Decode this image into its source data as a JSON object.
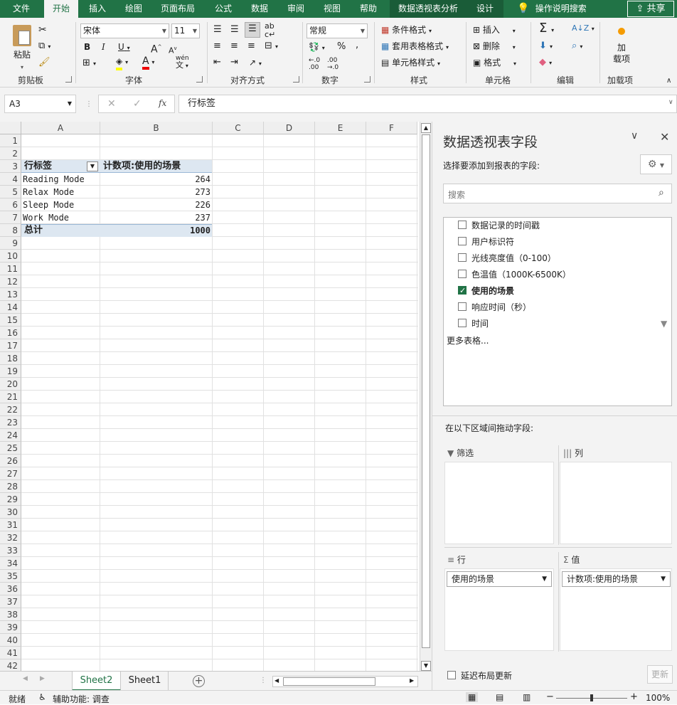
{
  "menu": {
    "tabs": [
      "文件",
      "开始",
      "插入",
      "绘图",
      "页面布局",
      "公式",
      "数据",
      "审阅",
      "视图",
      "帮助",
      "数据透视表分析",
      "设计"
    ],
    "active": "开始",
    "tell_me": "操作说明搜索",
    "share": "共享"
  },
  "ribbon": {
    "clipboard": {
      "label": "剪贴板",
      "paste": "粘贴"
    },
    "font": {
      "label": "字体",
      "name": "宋体",
      "size": "11",
      "bold": "B",
      "italic": "I",
      "underline": "U",
      "grow": "A",
      "shrink": "A",
      "wen": "wén"
    },
    "alignment": {
      "label": "对齐方式"
    },
    "number": {
      "label": "数字",
      "format": "常规"
    },
    "styles": {
      "label": "样式",
      "conditional": "条件格式",
      "table": "套用表格格式",
      "cell": "单元格样式"
    },
    "cells": {
      "label": "单元格",
      "insert": "插入",
      "delete": "删除",
      "format": "格式"
    },
    "editing": {
      "label": "编辑"
    },
    "addins": {
      "label": "加载项",
      "button": "加\n载项"
    }
  },
  "formula_bar": {
    "name_box": "A3",
    "fx": "fx",
    "formula": "行标签"
  },
  "grid": {
    "columns": [
      "A",
      "B",
      "C",
      "D",
      "E",
      "F"
    ],
    "row_count": 42,
    "pivot": {
      "header": [
        "行标签",
        "计数项:使用的场景"
      ],
      "rows": [
        {
          "label": "Reading Mode",
          "value": "264"
        },
        {
          "label": "Relax Mode",
          "value": "273"
        },
        {
          "label": "Sleep Mode",
          "value": "226"
        },
        {
          "label": "Work Mode",
          "value": "237"
        }
      ],
      "total": {
        "label": "总计",
        "value": "1000"
      }
    }
  },
  "sheets": [
    "Sheet2",
    "Sheet1"
  ],
  "active_sheet": "Sheet2",
  "status": {
    "ready": "就绪",
    "accessibility": "辅助功能: 调查",
    "zoom": "100%"
  },
  "pane": {
    "title": "数据透视表字段",
    "subtitle": "选择要添加到报表的字段:",
    "search_placeholder": "搜索",
    "fields": [
      {
        "name": "数据记录的时间戳",
        "checked": false
      },
      {
        "name": "用户标识符",
        "checked": false
      },
      {
        "name": "光线亮度值（0-100）",
        "checked": false
      },
      {
        "name": "色温值（1000K-6500K）",
        "checked": false
      },
      {
        "name": "使用的场景",
        "checked": true
      },
      {
        "name": "响应时间（秒）",
        "checked": false
      },
      {
        "name": "时间",
        "checked": false
      }
    ],
    "more_tables": "更多表格...",
    "drag_hint": "在以下区域间拖动字段:",
    "areas": {
      "filter": "筛选",
      "columns": "列",
      "rows": "行",
      "values": "值"
    },
    "rows_item": "使用的场景",
    "values_item": "计数项:使用的场景",
    "defer": "延迟布局更新",
    "update": "更新"
  }
}
